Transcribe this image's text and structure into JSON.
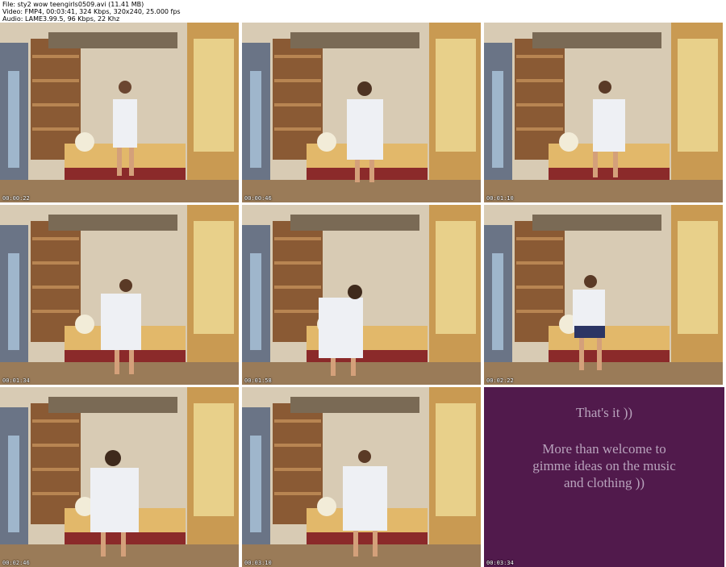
{
  "header": {
    "file_line": "File: sty2 wow teengirls0509.avi (11.41 MB)",
    "video_line": "Video: FMP4, 00:03:41, 324 Kbps, 320x240, 25.000 fps",
    "audio_line": "Audio: LAME3.99.5, 96 Kbps, 22 Khz"
  },
  "thumbnails": [
    {
      "timestamp": "00:00:22"
    },
    {
      "timestamp": "00:00:46"
    },
    {
      "timestamp": "00:01:10"
    },
    {
      "timestamp": "00:01:34"
    },
    {
      "timestamp": "00:01:58"
    },
    {
      "timestamp": "00:02:22"
    },
    {
      "timestamp": "00:02:46"
    },
    {
      "timestamp": "00:03:10"
    }
  ],
  "end_card": {
    "line1": "That's it ))",
    "line2a": "More than welcome to",
    "line2b": "gimme ideas on the music",
    "line2c": "and clothing ))",
    "timestamp": "00:03:34",
    "background": "#511a4c"
  }
}
